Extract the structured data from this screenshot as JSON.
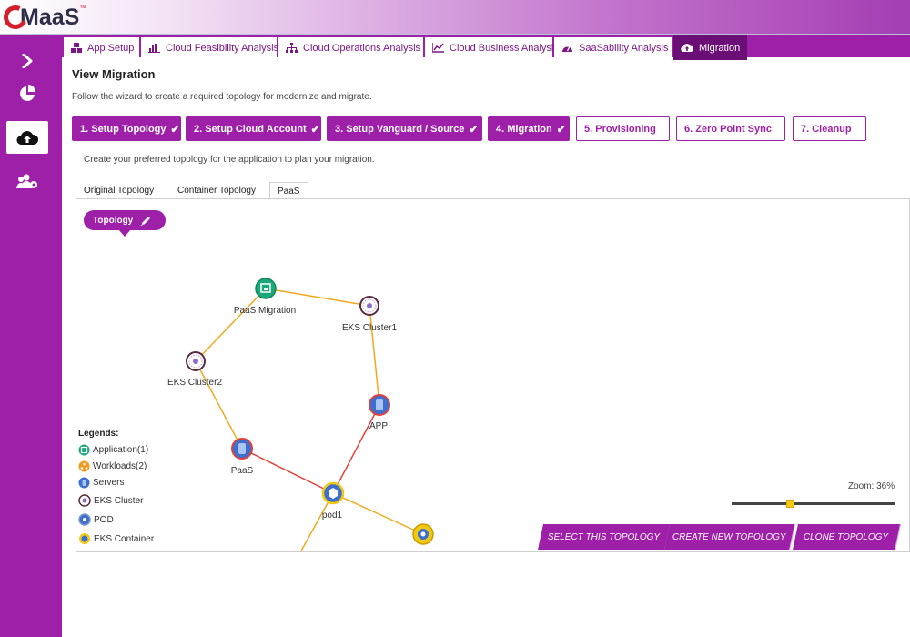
{
  "app": {
    "logo_text": "MaaS",
    "logo_tm": "™"
  },
  "colors": {
    "brand": "#9e1fa8",
    "brand_dark": "#6b0e75",
    "logo_red": "#d61f2c",
    "edge_orange": "#f2a81d",
    "edge_red": "#e0403a"
  },
  "sidebar": {
    "items": [
      {
        "icon": "chevron-right-icon"
      },
      {
        "icon": "pie-chart-icon"
      },
      {
        "icon": "cloud-upload-icon",
        "active": true
      },
      {
        "icon": "users-gear-icon"
      }
    ]
  },
  "tabs": [
    {
      "label": "App Setup",
      "icon": "cubes-icon"
    },
    {
      "label": "Cloud Feasibility Analysis",
      "icon": "bar-chart-icon"
    },
    {
      "label": "Cloud Operations Analysis",
      "icon": "sitemap-icon"
    },
    {
      "label": "Cloud Business Analysis",
      "icon": "line-chart-icon"
    },
    {
      "label": "SaaSability Analysis",
      "icon": "gauge-icon"
    },
    {
      "label": "Migration",
      "icon": "cloud-upload-icon",
      "active": true
    }
  ],
  "page": {
    "title": "View Migration",
    "subtitle": "Follow the wizard to create a required topology for modernize and migrate."
  },
  "steps": [
    {
      "label": "1. Setup Topology",
      "done": true
    },
    {
      "label": "2. Setup Cloud Account",
      "done": true
    },
    {
      "label": "3. Setup Vanguard / Source",
      "done": true
    },
    {
      "label": "4. Migration",
      "done": true
    },
    {
      "label": "5. Provisioning",
      "done": false
    },
    {
      "label": "6. Zero Point Sync",
      "done": false
    },
    {
      "label": "7. Cleanup",
      "done": false
    }
  ],
  "instruction": "Create your preferred topology for the application to plan your migration.",
  "topology_tabs": [
    {
      "label": "Original Topology"
    },
    {
      "label": "Container Topology"
    },
    {
      "label": "PaaS",
      "active": true
    }
  ],
  "topology_pill": {
    "label": "Topology",
    "icon": "pencil-icon"
  },
  "graph": {
    "nodes": [
      {
        "id": "paas-migration",
        "label": "PaaS Migration",
        "type": "application"
      },
      {
        "id": "eks-cluster1",
        "label": "EKS Cluster1",
        "type": "eks-cluster"
      },
      {
        "id": "eks-cluster2",
        "label": "EKS Cluster2",
        "type": "eks-cluster"
      },
      {
        "id": "app",
        "label": "APP",
        "type": "server"
      },
      {
        "id": "paas",
        "label": "PaaS",
        "type": "server"
      },
      {
        "id": "pod1",
        "label": "pod1",
        "type": "pod"
      },
      {
        "id": "container",
        "label": "",
        "type": "eks-container"
      }
    ],
    "edges": [
      {
        "from": "paas-migration",
        "to": "eks-cluster1",
        "color": "orange"
      },
      {
        "from": "paas-migration",
        "to": "eks-cluster2",
        "color": "orange"
      },
      {
        "from": "eks-cluster1",
        "to": "app",
        "color": "orange"
      },
      {
        "from": "eks-cluster2",
        "to": "paas",
        "color": "orange"
      },
      {
        "from": "app",
        "to": "pod1",
        "color": "red"
      },
      {
        "from": "paas",
        "to": "pod1",
        "color": "red"
      },
      {
        "from": "pod1",
        "to": "container",
        "color": "orange"
      }
    ]
  },
  "legend": {
    "title": "Legends:",
    "items": [
      {
        "label": "Application(1)",
        "icon": "application-icon",
        "color": "#1aa87a"
      },
      {
        "label": "Workloads(2)",
        "icon": "workloads-icon",
        "color": "#f39a1e"
      },
      {
        "label": "Servers",
        "icon": "server-icon",
        "color": "#3d6fd1"
      },
      {
        "label": "EKS Cluster",
        "icon": "eks-cluster-icon",
        "color": "#5a2a3e"
      },
      {
        "label": "POD",
        "icon": "pod-icon",
        "color": "#3d6fd1"
      },
      {
        "label": "EKS Container",
        "icon": "eks-container-icon",
        "color": "#f2c811"
      }
    ]
  },
  "zoom": {
    "label": "Zoom: 36%",
    "value_percent": 36
  },
  "actions": [
    {
      "label": "SELECT THIS TOPOLOGY"
    },
    {
      "label": "CREATE NEW TOPOLOGY"
    },
    {
      "label": "CLONE TOPOLOGY"
    }
  ]
}
